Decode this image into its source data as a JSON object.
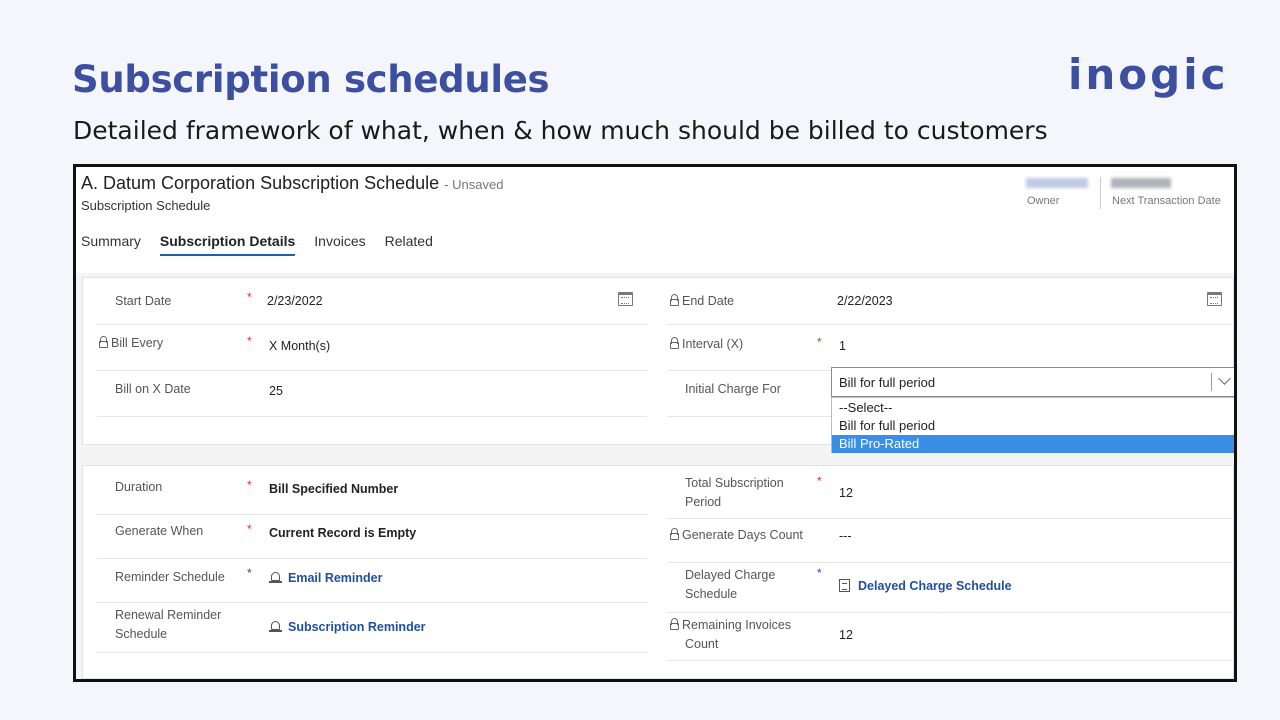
{
  "slide": {
    "title": "Subscription schedules",
    "subtitle": "Detailed framework of what, when & how much should be billed to customers",
    "logo": "inogic",
    "brand_color": "#3d4fa1"
  },
  "record": {
    "title": "A. Datum Corporation Subscription Schedule",
    "unsaved": "- Unsaved",
    "entity": "Subscription Schedule",
    "owner_label": "Owner",
    "next_transaction_label": "Next Transaction Date"
  },
  "tabs": [
    {
      "label": "Summary",
      "active": false
    },
    {
      "label": "Subscription Details",
      "active": true
    },
    {
      "label": "Invoices",
      "active": false
    },
    {
      "label": "Related",
      "active": false
    }
  ],
  "section1": {
    "start_date": {
      "label": "Start Date",
      "value": "2/23/2022",
      "required": "*"
    },
    "end_date": {
      "label": "End Date",
      "value": "2/22/2023"
    },
    "bill_every": {
      "label": "Bill Every",
      "value": "X Month(s)",
      "required": "*"
    },
    "interval": {
      "label": "Interval (X)",
      "value": "1",
      "required": "*"
    },
    "bill_on_x_date": {
      "label": "Bill on X Date",
      "value": "25"
    },
    "initial_charge_for": {
      "label": "Initial Charge For",
      "value": "Bill for full period",
      "options": [
        "--Select--",
        "Bill for full period",
        "Bill Pro-Rated"
      ],
      "highlighted": "Bill Pro-Rated"
    }
  },
  "section2": {
    "duration": {
      "label": "Duration",
      "value": "Bill Specified Number",
      "required": "*"
    },
    "total_subscription_period": {
      "label_1": "Total Subscription",
      "label_2": "Period",
      "value": "12",
      "required": "*"
    },
    "generate_when": {
      "label": "Generate When",
      "value": "Current Record is Empty",
      "required": "*"
    },
    "generate_days_count": {
      "label": "Generate Days Count",
      "value": "---"
    },
    "reminder_schedule": {
      "label": "Reminder Schedule",
      "value": "Email Reminder",
      "required": "*"
    },
    "delayed_charge_schedule": {
      "label_1": "Delayed Charge",
      "label_2": "Schedule",
      "value": "Delayed Charge Schedule",
      "required": "*"
    },
    "renewal_reminder_schedule": {
      "label_1": "Renewal Reminder",
      "label_2": "Schedule",
      "value": "Subscription Reminder"
    },
    "remaining_invoices_count": {
      "label_1": "Remaining Invoices",
      "label_2": "Count",
      "value": "12"
    }
  }
}
